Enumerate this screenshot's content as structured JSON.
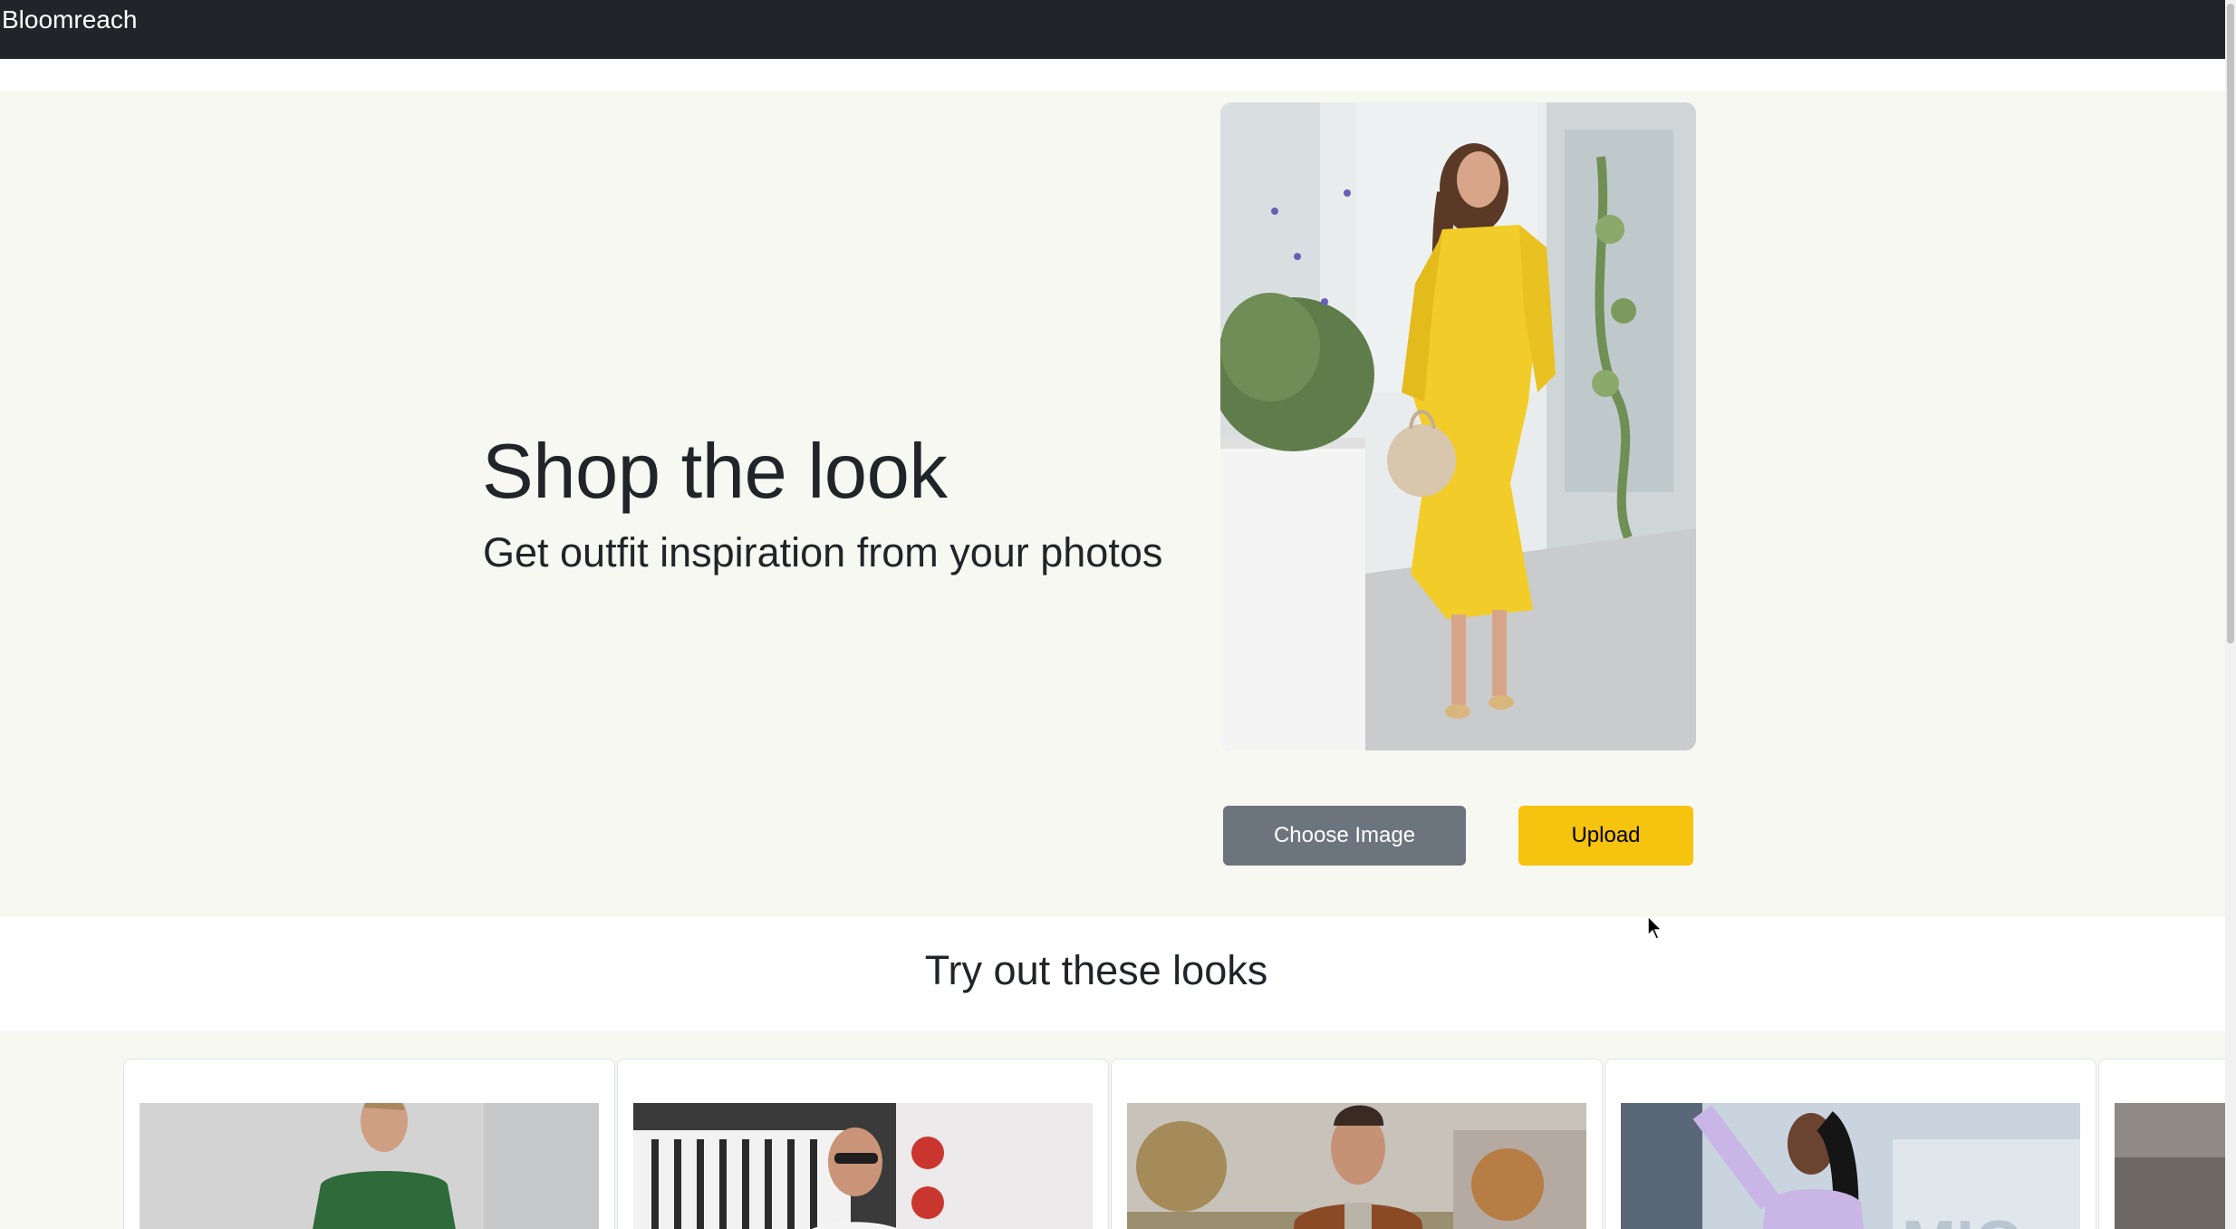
{
  "navbar": {
    "brand": "Bloomreach",
    "bg": "#212529"
  },
  "hero": {
    "title": "Shop the look",
    "subtitle": "Get outfit inspiration from your photos",
    "image_alt": "woman-in-yellow-dress-photo",
    "choose_label": "Choose Image",
    "upload_label": "Upload",
    "bg": "#f7f8f1"
  },
  "looks": {
    "heading": "Try out these looks",
    "cards": [
      {
        "alt": "woman-in-green-dress"
      },
      {
        "alt": "man-in-sunglasses-white-tee"
      },
      {
        "alt": "man-in-brown-leather-jacket"
      },
      {
        "alt": "woman-in-lavender-top"
      },
      {
        "alt": "partial-look-card"
      }
    ]
  },
  "colors": {
    "accent": "#f6c30f",
    "secondary": "#6c757d",
    "dark": "#212529"
  }
}
